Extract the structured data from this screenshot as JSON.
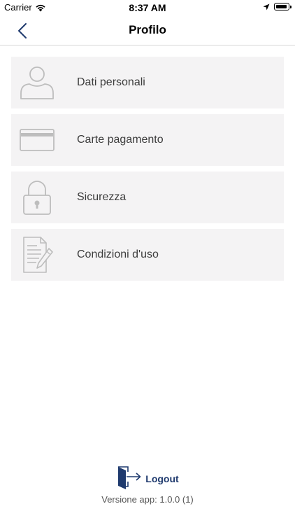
{
  "status_bar": {
    "carrier": "Carrier",
    "time": "8:37 AM"
  },
  "nav": {
    "title": "Profilo"
  },
  "menu": {
    "items": [
      {
        "label": "Dati personali",
        "icon": "user-icon"
      },
      {
        "label": "Carte pagamento",
        "icon": "credit-card-icon"
      },
      {
        "label": "Sicurezza",
        "icon": "lock-icon"
      },
      {
        "label": "Condizioni d'uso",
        "icon": "document-pen-icon"
      }
    ]
  },
  "footer": {
    "logout_label": "Logout",
    "version": "Versione app: 1.0.0 (1)"
  },
  "colors": {
    "accent": "#1f3a6e",
    "item_background": "#f4f3f4",
    "icon_gray": "#bdbdbd",
    "label_text": "#3c3c3c"
  }
}
